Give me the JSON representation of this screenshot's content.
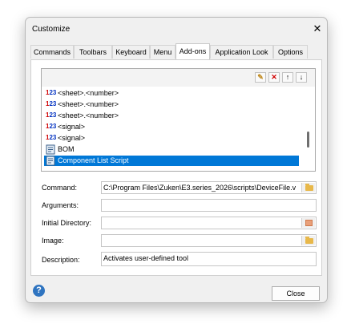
{
  "window": {
    "title": "Customize",
    "close_glyph": "✕"
  },
  "tabs": [
    {
      "label": "Commands"
    },
    {
      "label": "Toolbars"
    },
    {
      "label": "Keyboard"
    },
    {
      "label": "Menu"
    },
    {
      "label": "Add-ons"
    },
    {
      "label": "Application Look"
    },
    {
      "label": "Options"
    }
  ],
  "active_tab": "Add-ons",
  "list_toolbar": {
    "buttons": [
      {
        "icon": "new-item-icon",
        "glyph": "✎"
      },
      {
        "icon": "delete-icon",
        "glyph": "✕"
      },
      {
        "icon": "move-up-icon",
        "glyph": "↑"
      },
      {
        "icon": "move-down-icon",
        "glyph": "↓"
      }
    ]
  },
  "list": {
    "items": [
      {
        "icon": "numeric-123-icon",
        "label": "<sheet>.<number>"
      },
      {
        "icon": "numeric-123-icon",
        "label": "<sheet>.<number>"
      },
      {
        "icon": "numeric-123-icon",
        "label": "<sheet>.<number>"
      },
      {
        "icon": "numeric-123-icon",
        "label": "<signal>"
      },
      {
        "icon": "numeric-123-icon",
        "label": "<signal>"
      },
      {
        "icon": "script-icon",
        "label": "BOM"
      },
      {
        "icon": "script-icon",
        "label": "Component List Script"
      }
    ],
    "selected_index": 6
  },
  "form": {
    "command": {
      "label": "Command:",
      "value": "C:\\Program Files\\Zuken\\E3.series_2026\\scripts\\DeviceFile.v"
    },
    "arguments": {
      "label": "Arguments:",
      "value": ""
    },
    "initial_directory": {
      "label": "Initial Directory:",
      "value": ""
    },
    "image": {
      "label": "Image:",
      "value": ""
    },
    "description": {
      "label": "Description:",
      "value": "Activates user-defined tool"
    }
  },
  "footer": {
    "help_glyph": "?",
    "close_label": "Close"
  },
  "colors": {
    "selection": "#0078d7",
    "accent": "#2f74c0"
  }
}
